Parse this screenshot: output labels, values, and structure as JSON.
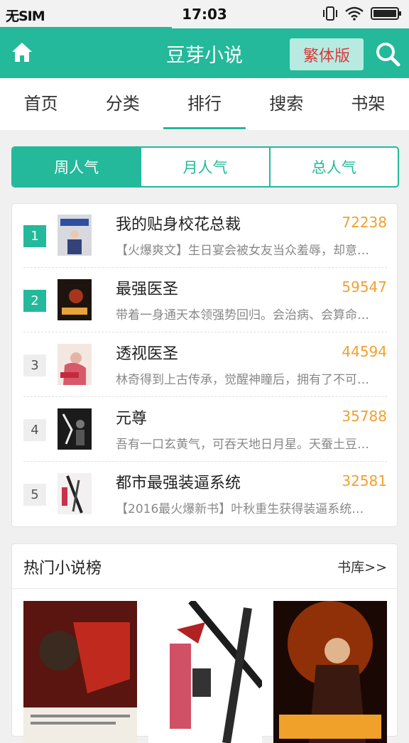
{
  "status": {
    "carrier": "无SIM",
    "time": "17:03"
  },
  "header": {
    "title": "豆芽小说",
    "traditional_label": "繁体版"
  },
  "nav": {
    "tabs": [
      {
        "label": "首页"
      },
      {
        "label": "分类"
      },
      {
        "label": "排行"
      },
      {
        "label": "搜索"
      },
      {
        "label": "书架"
      }
    ],
    "active": "排行"
  },
  "ranking_tabs": {
    "items": [
      {
        "label": "周人气"
      },
      {
        "label": "月人气"
      },
      {
        "label": "总人气"
      }
    ],
    "active": "周人气"
  },
  "ranking": {
    "items": [
      {
        "rank": "1",
        "title": "我的贴身校花总裁",
        "score": "72238",
        "desc": "【火爆爽文】生日宴会被女友当众羞辱，却意…"
      },
      {
        "rank": "2",
        "title": "最强医圣",
        "score": "59547",
        "desc": "带着一身通天本领强势回归。会治病、会算命…"
      },
      {
        "rank": "3",
        "title": "透视医圣",
        "score": "44594",
        "desc": "林奇得到上古传承，觉醒神瞳后，拥有了不可…"
      },
      {
        "rank": "4",
        "title": "元尊",
        "score": "35788",
        "desc": "吾有一口玄黄气，可吞天地日月星。天蚕土豆…"
      },
      {
        "rank": "5",
        "title": "都市最强装逼系统",
        "score": "32581",
        "desc": "【2016最火爆新书】叶秋重生获得装逼系统…"
      }
    ]
  },
  "hot": {
    "title": "热门小说榜",
    "more_label": "书库>>"
  },
  "colors": {
    "accent": "#23b99a",
    "score": "#f0a030",
    "traditional_text": "#d83a3a"
  }
}
